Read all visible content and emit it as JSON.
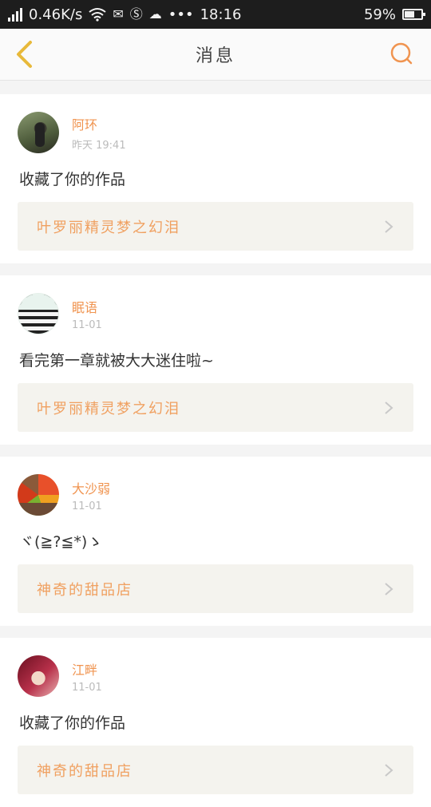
{
  "status_bar": {
    "speed": "0.46K/s",
    "time": "18:16",
    "battery": "59%",
    "battery_level": 0.59,
    "dots": "•••"
  },
  "header": {
    "title": "消息"
  },
  "messages": [
    {
      "username": "阿环",
      "time": "昨天 19:41",
      "content": "收藏了你的作品",
      "reference": "叶罗丽精灵梦之幻泪",
      "avatar": "avatar-person-outdoor"
    },
    {
      "username": "眠语",
      "time": "11-01",
      "content": "看完第一章就被大大迷住啦~",
      "reference": "叶罗丽精灵梦之幻泪",
      "avatar": "avatar-striped-sweater"
    },
    {
      "username": "大沙弱",
      "time": "11-01",
      "content": "ヾ(≧?≦*)ゝ",
      "reference": "神奇的甜品店",
      "avatar": "avatar-autumn-leaves"
    },
    {
      "username": "江畔",
      "time": "11-01",
      "content": "收藏了你的作品",
      "reference": "神奇的甜品店",
      "avatar": "avatar-book-red"
    }
  ],
  "colors": {
    "accent": "#f09450",
    "back_arrow": "#e8b93a",
    "search": "#f09450"
  }
}
